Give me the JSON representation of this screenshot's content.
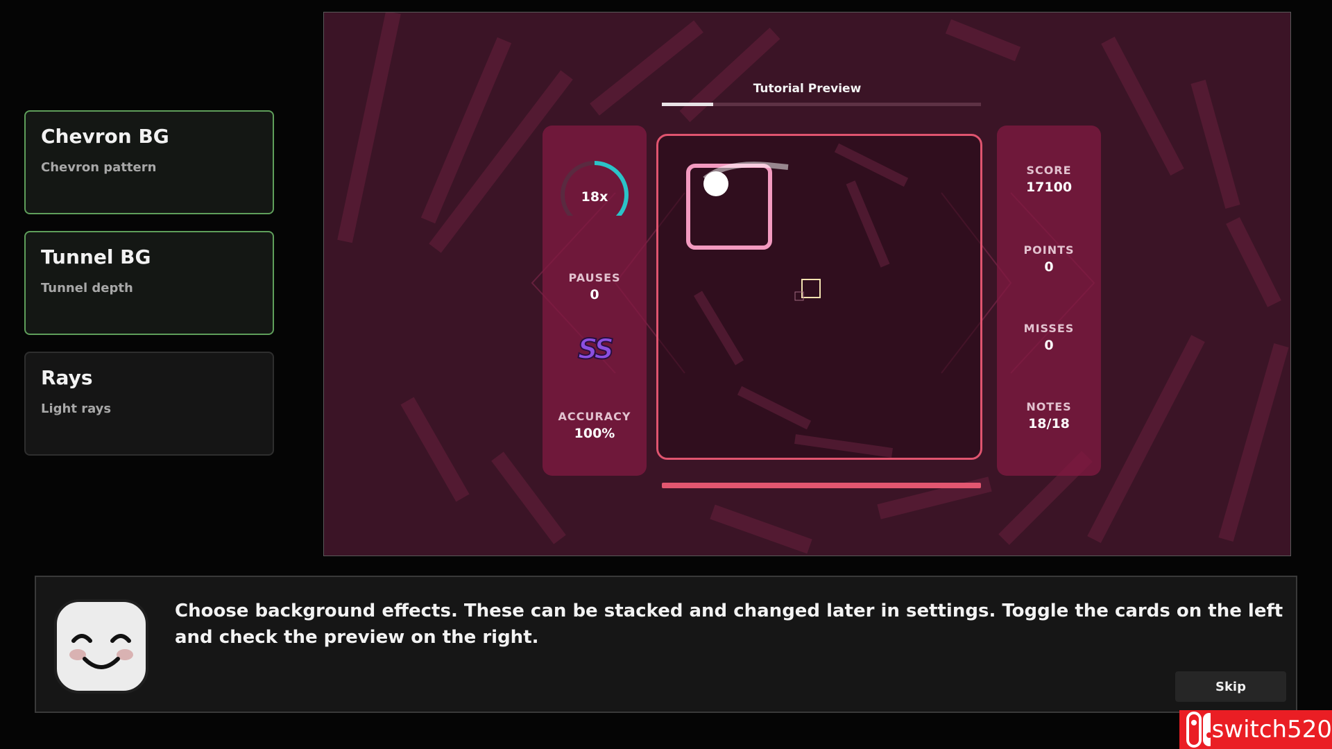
{
  "cards": [
    {
      "title": "Chevron BG",
      "subtitle": "Chevron pattern",
      "active": true
    },
    {
      "title": "Tunnel BG",
      "subtitle": "Tunnel depth",
      "active": true
    },
    {
      "title": "Rays",
      "subtitle": "Light rays",
      "active": false
    }
  ],
  "preview": {
    "title": "Tutorial Preview",
    "progress_fraction": 0.16,
    "combo": "18x",
    "combo_fraction": 0.55,
    "pauses_label": "PAUSES",
    "pauses_value": "0",
    "rank": "SS",
    "accuracy_label": "ACCURACY",
    "accuracy_value": "100%",
    "score_label": "SCORE",
    "score_value": "17100",
    "points_label": "POINTS",
    "points_value": "0",
    "misses_label": "MISSES",
    "misses_value": "0",
    "notes_label": "NOTES",
    "notes_value": "18/18"
  },
  "dialog": {
    "text": "Choose background effects. These can be stacked and changed later in settings. Toggle the cards on the left and check the preview on the right.",
    "skip_label": "Skip"
  },
  "watermark": {
    "text": "switch520"
  },
  "colors": {
    "accent_green": "#5f9f5b",
    "preview_bg": "#3b1426",
    "panel": "#821a42",
    "play_border": "#e0546f",
    "combo_ring": "#2bc3c8",
    "rank_purple": "#8b4fe0",
    "watermark_red": "#ea1e24"
  }
}
